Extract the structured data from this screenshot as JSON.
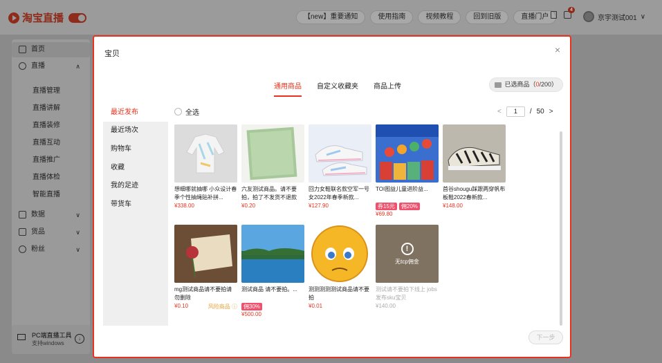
{
  "app": {
    "title": "淘宝直播"
  },
  "topnav": [
    {
      "label": "【new】重要通知"
    },
    {
      "label": "使用指南"
    },
    {
      "label": "视频教程"
    },
    {
      "label": "回到旧版"
    },
    {
      "label": "直播门户"
    }
  ],
  "notifications": {
    "count": "4"
  },
  "user": {
    "name": "京宇测试001",
    "caret": "∨"
  },
  "sidebar": {
    "items": [
      {
        "label": "首页",
        "icon": "home-icon"
      },
      {
        "label": "直播",
        "icon": "play-circle-icon",
        "arrow": "∧"
      },
      {
        "label": "数据",
        "icon": "chart-icon",
        "arrow": "∨"
      },
      {
        "label": "货品",
        "icon": "bag-icon",
        "arrow": "∨"
      },
      {
        "label": "粉丝",
        "icon": "users-icon",
        "arrow": "∨"
      }
    ],
    "sub": [
      "直播管理",
      "直播讲解",
      "直播装修",
      "直播互动",
      "直播推广",
      "直播体检",
      "智能直播"
    ],
    "pc_tool": {
      "title": "PC端直播工具",
      "subtitle": "支持windows"
    }
  },
  "modal": {
    "title": "宝贝",
    "close": "×",
    "tabs": [
      {
        "label": "通用商品",
        "active": true
      },
      {
        "label": "自定义收藏夹"
      },
      {
        "label": "商品上传"
      }
    ],
    "selected": {
      "prefix": "已选商品（",
      "count": "0",
      "suffix": "/200）"
    },
    "categories": [
      {
        "label": "最近发布",
        "active": true
      },
      {
        "label": "最近场次"
      },
      {
        "label": "购物车"
      },
      {
        "label": "收藏"
      },
      {
        "label": "我的足迹"
      },
      {
        "label": "带货车"
      }
    ],
    "select_all": "全选",
    "pager": {
      "prev": "<",
      "current": "1",
      "separator": "/",
      "total": "50",
      "next": ">"
    },
    "next_button": "下一步",
    "products": [
      {
        "name": "想细哪就抽哪 小众设计春季个性抽绳贴补拼...",
        "price": "¥338.00",
        "tags": [],
        "risk": "",
        "image": "jacket"
      },
      {
        "name": "六友测试商品。请不要拍，拍了不发货不退款",
        "price": "¥0.20",
        "tags": [],
        "risk": "",
        "image": "towel"
      },
      {
        "name": "回力女鞋联名款空军一号女2022年春季新款...",
        "price": "¥127.90",
        "tags": [],
        "risk": "",
        "image": "shoes"
      },
      {
        "name": "TOI图益儿童进阶益...",
        "price": "¥69.80",
        "tags": [
          "券15元",
          "佣20%"
        ],
        "risk": "",
        "image": "toy"
      },
      {
        "name": "首谷shougu踩跟两穿帆布板鞋2022春新款...",
        "price": "¥148.00",
        "tags": [],
        "risk": "",
        "image": "sneaker"
      },
      {
        "name": "mg测试商品请不要拍请勿删除",
        "price": "¥0.10",
        "tags": [],
        "risk": "风险商品 ⓘ",
        "image": "rose"
      },
      {
        "name": "测试商品 请不要拍。...",
        "price": "¥500.00",
        "tags": [
          "佣30%"
        ],
        "risk": "",
        "image": "lake"
      },
      {
        "name": "测测测测测试商品请不要拍",
        "price": "¥0.01",
        "tags": [],
        "risk": "",
        "image": "emoji"
      },
      {
        "name": "测试请不要拍下线上 jobs发布sku宝贝",
        "price": "¥140.00",
        "tags": [],
        "risk": "",
        "image": "cake",
        "overlay": "无tcp佣金",
        "disabled": true
      }
    ]
  },
  "colors": {
    "accent": "#e8321e",
    "tag": "#f0506b",
    "risk": "#e8a23e"
  }
}
